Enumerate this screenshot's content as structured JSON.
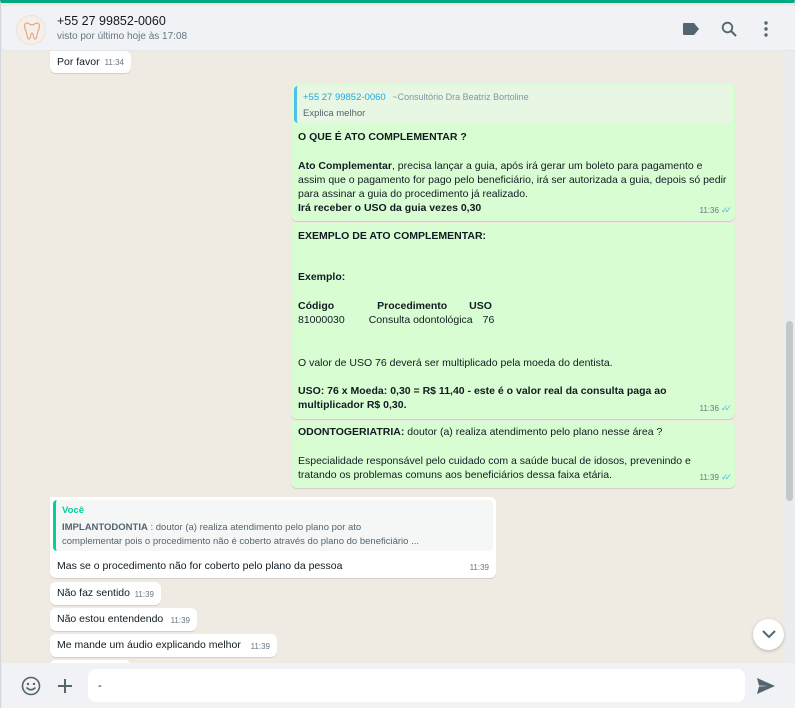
{
  "header": {
    "contact_name": "+55 27 99852-0060",
    "contact_status": "visto por último hoje às 17:08",
    "icons": [
      "tag-icon",
      "search-icon",
      "more-vertical-icon"
    ]
  },
  "messages": {
    "m1": {
      "text": "Por favor",
      "time": "11:34"
    },
    "m2": {
      "quote_author": "+55 27 99852-0060",
      "quote_group": "~Consultório Dra Beatriz Bortoline",
      "quote_text": "Explica melhor",
      "heading": "O QUE É ATO COMPLEMENTAR ?",
      "p1_bold": "Ato Complementar",
      "p1_line1": ", precisa lançar a guia, após irá gerar um boleto para pagamento e",
      "p1_line2": "assim que o pagamento for pago pelo beneficiário, irá ser autorizada a guia, depois só pedir",
      "p1_line3": "para assinar a guia do procedimento já realizado.",
      "p1_line4": "Irá receber o USO da guia vezes 0,30",
      "time": "11:36"
    },
    "m3": {
      "heading": "EXEMPLO DE ATO COMPLEMENTAR:",
      "exemplo": "Exemplo:",
      "col_codigo": "Código",
      "col_procedimento": "Procedimento",
      "col_uso": "USO",
      "val_codigo": "81000030",
      "val_procedimento": "Consulta odontológica",
      "val_uso": "76",
      "line_valor": "O valor de USO 76 deverá ser multiplicado pela moeda do dentista.",
      "line_calc1": "USO: 76 x Moeda: 0,30 = R$ 11,40 -  este é o valor real da consulta paga ao",
      "line_calc2": "multiplicador R$ 0,30.",
      "time": "11:36"
    },
    "m4": {
      "heading": "ODONTOGERIATRIA:",
      "heading_rest": "  doutor (a) realiza atendimento pelo plano nesse área ?",
      "line1": "Especialidade responsável pelo cuidado com a saúde bucal de idosos, prevenindo e",
      "line2": "tratando os problemas comuns aos beneficiários dessa faixa etária.",
      "time": "11:39"
    },
    "m5": {
      "quote_author": "Você",
      "quote_bold": "IMPLANTODONTIA",
      "quote_line1": " : doutor (a) realiza atendimento pelo plano por ato",
      "quote_line2": "complementar pois o procedimento não é coberto através do plano do beneficiário ...",
      "text": "Mas se o procedimento não for coberto pelo plano da pessoa",
      "time": "11:39"
    },
    "m6": {
      "text": "Não faz sentido",
      "time": "11:39"
    },
    "m7": {
      "text": "Não estou entendendo",
      "time": "11:39"
    },
    "m8": {
      "text": "Me mande um áudio explicando melhor",
      "time": "11:39"
    }
  },
  "composer": {
    "value": "-",
    "icons": [
      "emoji-icon",
      "plus-icon",
      "send-icon"
    ]
  },
  "colors": {
    "incoming": "#ffffff",
    "outgoing": "#d9fdd3",
    "accent": "#00a884",
    "read_ticks": "#53bdeb"
  }
}
